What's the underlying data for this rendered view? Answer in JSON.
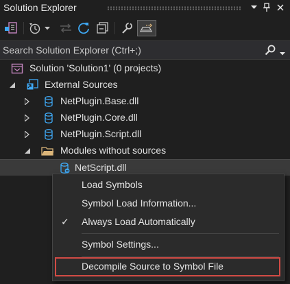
{
  "window": {
    "title": "Solution Explorer",
    "buttons": {
      "dropdown": "▾",
      "pin": "pin-icon",
      "close": "✕"
    }
  },
  "toolbar": {
    "buttons": [
      "switch-views-icon",
      "pending-changes-filter-icon",
      "sync-with-document-icon",
      "refresh-icon",
      "collapse-all-icon",
      "properties-icon",
      "preview-selected-items-icon"
    ]
  },
  "search": {
    "placeholder": "Search Solution Explorer (Ctrl+;)"
  },
  "tree": {
    "solution": "Solution 'Solution1' (0 projects)",
    "external_sources": "External Sources",
    "items": [
      "NetPlugin.Base.dll",
      "NetPlugin.Core.dll",
      "NetPlugin.Script.dll"
    ],
    "modules_without_sources": "Modules without sources",
    "selected": "NetScript.dll"
  },
  "context_menu": {
    "load_symbols": "Load Symbols",
    "symbol_load_information": "Symbol Load Information...",
    "always_load_automatically": "Always Load Automatically",
    "always_load_checked": "✓",
    "symbol_settings": "Symbol Settings...",
    "decompile_source": "Decompile Source to Symbol File"
  },
  "colors": {
    "background": "#1f1f1f",
    "menu_background": "#2b2b2b",
    "highlight_outline": "#d24b45",
    "accent_blue": "#3fa9f5",
    "folder_yellow": "#dcb67a"
  }
}
